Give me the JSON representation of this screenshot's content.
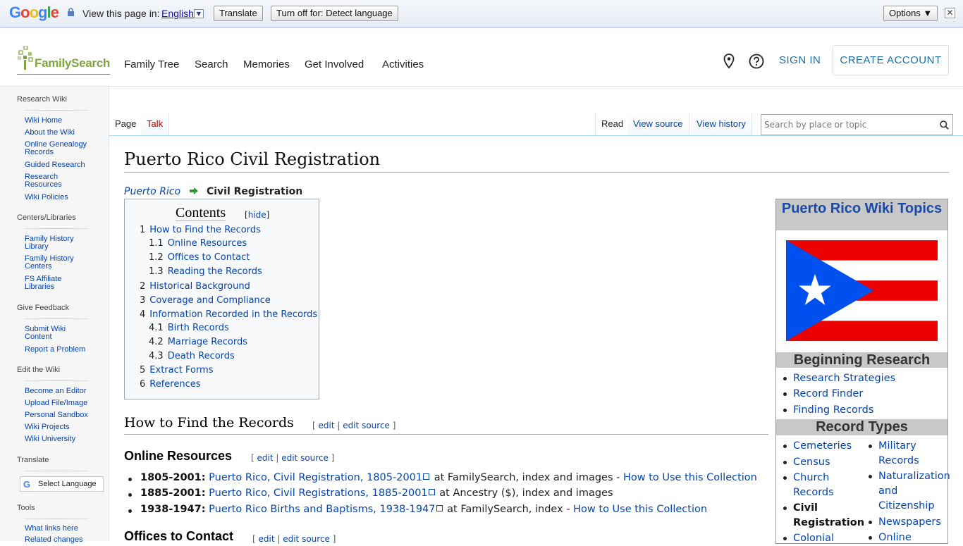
{
  "translate_bar": {
    "view_text": "View this page in:",
    "language": "English",
    "translate_label": "Translate",
    "turn_off_label": "Turn off for: Detect language",
    "options_label": "Options ▼",
    "close_symbol": "✕"
  },
  "header": {
    "logo_text": "FamilySearch",
    "nav": [
      "Family Tree",
      "Search",
      "Memories",
      "Get Involved",
      "Activities"
    ],
    "sign_in": "SIGN IN",
    "create_account": "CREATE ACCOUNT"
  },
  "sidebar": {
    "sections": [
      {
        "heading": "Research Wiki",
        "items": [
          "Wiki Home",
          "About the Wiki",
          "Online Genealogy Records",
          "Guided Research",
          "Research Resources",
          "Wiki Policies"
        ]
      },
      {
        "heading": "Centers/Libraries",
        "items": [
          "Family History Library",
          "Family History Centers",
          "FS Affiliate Libraries"
        ]
      },
      {
        "heading": "Give Feedback",
        "items": [
          "Submit Wiki Content",
          "Report a Problem"
        ]
      },
      {
        "heading": "Edit the Wiki",
        "items": [
          "Become an Editor",
          "Upload File/Image",
          "Personal Sandbox",
          "Wiki Projects",
          "Wiki University"
        ]
      },
      {
        "heading": "Translate",
        "items": []
      },
      {
        "heading": "Tools",
        "items": [
          "What links here",
          "Related changes"
        ]
      }
    ],
    "translate_widget": "Select Language"
  },
  "tabs": {
    "page": "Page",
    "talk": "Talk",
    "read": "Read",
    "view_source": "View source",
    "view_history": "View history"
  },
  "search": {
    "placeholder": "Search by place or topic"
  },
  "article": {
    "title": "Puerto Rico Civil Registration",
    "breadcrumb_parent": "Puerto Rico",
    "breadcrumb_current": "Civil Registration",
    "toc": {
      "heading": "Contents",
      "hide_label": "hide",
      "items": [
        {
          "num": "1",
          "text": "How to Find the Records",
          "level": 1
        },
        {
          "num": "1.1",
          "text": "Online Resources",
          "level": 2
        },
        {
          "num": "1.2",
          "text": "Offices to Contact",
          "level": 2
        },
        {
          "num": "1.3",
          "text": "Reading the Records",
          "level": 2
        },
        {
          "num": "2",
          "text": "Historical Background",
          "level": 1
        },
        {
          "num": "3",
          "text": "Coverage and Compliance",
          "level": 1
        },
        {
          "num": "4",
          "text": "Information Recorded in the Records",
          "level": 1
        },
        {
          "num": "4.1",
          "text": "Birth Records",
          "level": 2
        },
        {
          "num": "4.2",
          "text": "Marriage Records",
          "level": 2
        },
        {
          "num": "4.3",
          "text": "Death Records",
          "level": 2
        },
        {
          "num": "5",
          "text": "Extract Forms",
          "level": 1
        },
        {
          "num": "6",
          "text": "References",
          "level": 1
        }
      ]
    },
    "h2_find": "How to Find the Records",
    "h3_online": "Online Resources",
    "h3_offices": "Offices to Contact",
    "edit_label": "edit",
    "edit_source_label": "edit source",
    "online_resources": [
      {
        "years": "1805-2001:",
        "link": "Puerto Rico, Civil Registration, 1805-2001",
        "rest": " at FamilySearch, index and images - ",
        "link2": "How to Use this Collection"
      },
      {
        "years": "1885-2001:",
        "link": "Puerto Rico, Civil Registrations, 1885-2001",
        "rest": " at Ancestry ($), index and images",
        "link2": ""
      },
      {
        "years": "1938-1947:",
        "link": "Puerto Rico Births and Baptisms, 1938-1947",
        "rest": " at FamilySearch, index - ",
        "link2": "How to Use this Collection"
      }
    ]
  },
  "infobox": {
    "title": "Puerto Rico Wiki Topics",
    "beginning_heading": "Beginning Research",
    "beginning_items": [
      "Research Strategies",
      "Record Finder",
      "Finding Records"
    ],
    "record_types_heading": "Record Types",
    "col1": [
      "Cemeteries",
      "Census",
      "Church Records",
      "Civil Registration",
      "Colonial"
    ],
    "col2": [
      "Military Records",
      "Naturalization and Citizenship",
      "Newspapers",
      "Online"
    ]
  },
  "colors": {
    "link": "#0645ad",
    "brand_green": "#80a442",
    "fs_blue": "#1b6fa8",
    "flag_red": "#ed0000",
    "flag_blue": "#0050f0"
  }
}
